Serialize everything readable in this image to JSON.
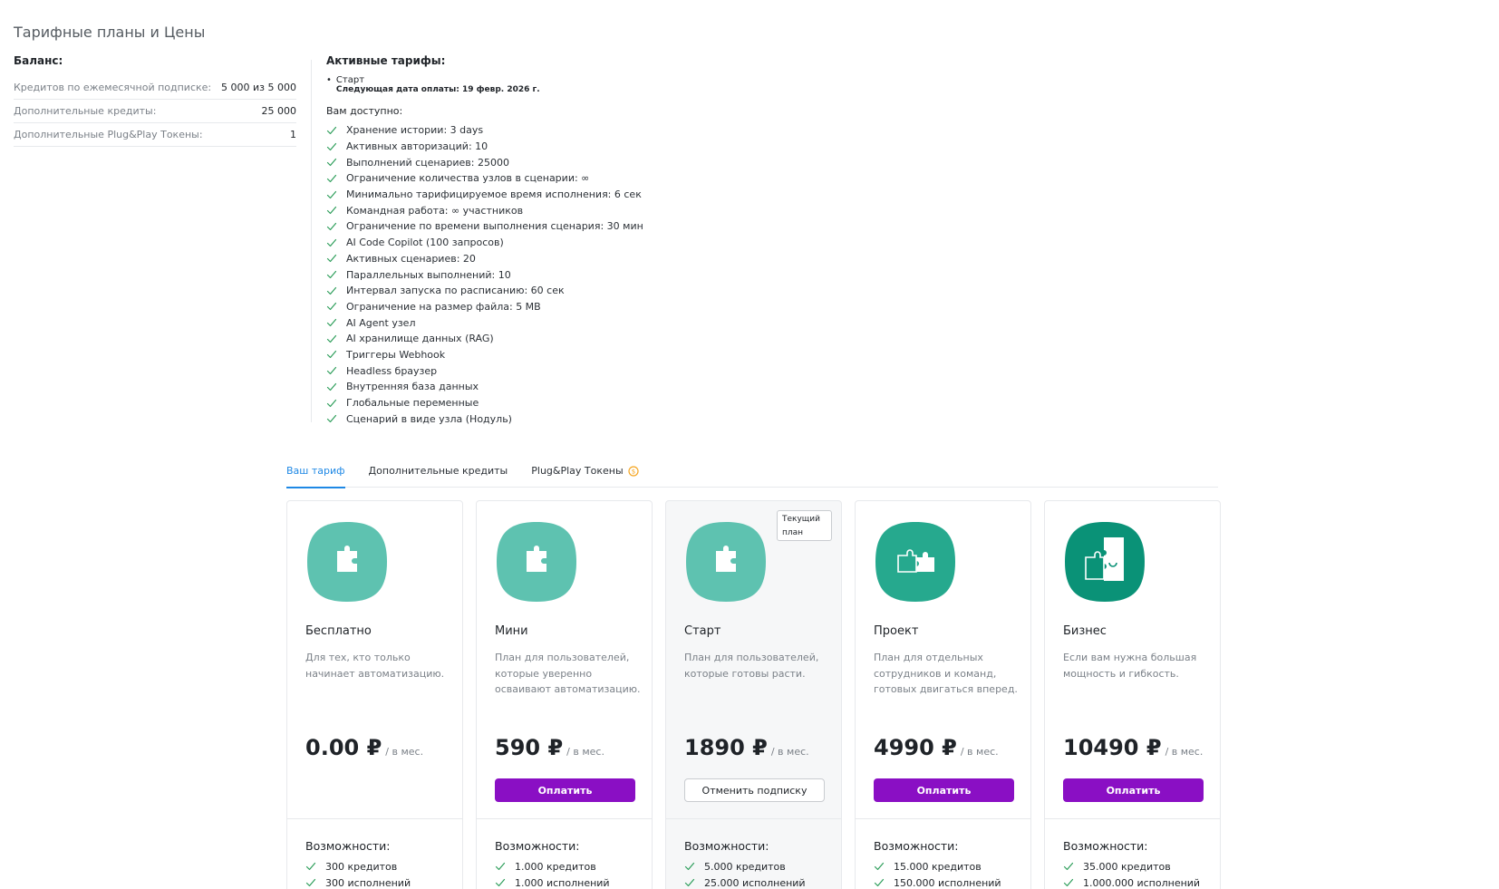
{
  "page_title": "Тарифные планы и Цены",
  "balance": {
    "title": "Баланс:",
    "rows": [
      {
        "label": "Кредитов по ежемесячной подписке:",
        "value": "5 000 из 5 000"
      },
      {
        "label": "Дополнительные кредиты:",
        "value": "25 000"
      },
      {
        "label": "Дополнительные Plug&Play Токены:",
        "value": "1"
      }
    ]
  },
  "active": {
    "title": "Активные тарифы:",
    "plan_name": "Старт",
    "next_payment": "Следующая дата оплаты: 19 февр. 2026 г.",
    "available_title": "Вам доступно:",
    "features": [
      "Хранение истории: 3 days",
      "Активных авторизаций: 10",
      "Выполнений сценариев: 25000",
      "Ограничение количества узлов в сценарии: ∞",
      "Минимально тарифицируемое время исполнения: 6 сек",
      "Командная работа: ∞ участников",
      "Ограничение по времени выполнения сценария: 30 мин",
      "AI Code Copilot (100 запросов)",
      "Активных сценариев: 20",
      "Параллельных выполнений: 10",
      "Интервал запуска по расписанию: 60 сек",
      "Ограничение на размер файла: 5 MB",
      "AI Agent узел",
      "AI хранилище данных (RAG)",
      "Триггеры Webhook",
      "Headless браузер",
      "Внутренняя база данных",
      "Глобальные переменные",
      "Сценарий в виде узла (Нодуль)"
    ]
  },
  "tabs": [
    "Ваш тариф",
    "Дополнительные кредиты",
    "Plug&Play Токены"
  ],
  "colors": {
    "accent_blue": "#1e88e5",
    "pay_button": "#8a0fc4",
    "check_green": "#2e9e5b",
    "icon_light": "#5ec2b0",
    "icon_mid": "#26a98e",
    "icon_dark": "#0a9277",
    "coin": "#f5a623"
  },
  "plans": [
    {
      "name": "Бесплатно",
      "desc": "Для тех, кто только начинает автоматизацию.",
      "price": "0.00 ₽",
      "per": "/ в мес.",
      "button": "",
      "features_title": "Возможности:",
      "features": [
        "300 кредитов",
        "300 исполнений"
      ],
      "icon": "puzzle-single-icon"
    },
    {
      "name": "Мини",
      "desc": "План для пользователей, которые уверенно осваивают автоматизацию.",
      "price": "590 ₽",
      "per": "/ в мес.",
      "button": "Оплатить",
      "features_title": "Возможности:",
      "features": [
        "1.000 кредитов",
        "1.000 исполнений"
      ],
      "icon": "puzzle-single-icon"
    },
    {
      "name": "Старт",
      "desc": "План для пользователей, которые готовы расти.",
      "price": "1890 ₽",
      "per": "/ в мес.",
      "button": "Отменить подписку",
      "badge": "Текущий план",
      "features_title": "Возможности:",
      "features": [
        "5.000 кредитов",
        "25.000 исполнений"
      ],
      "icon": "puzzle-single-icon"
    },
    {
      "name": "Проект",
      "desc": "План для отдельных сотрудников и команд, готовых двигаться вперед.",
      "price": "4990 ₽",
      "per": "/ в мес.",
      "button": "Оплатить",
      "features_title": "Возможности:",
      "features": [
        "15.000 кредитов",
        "150.000 исполнений"
      ],
      "icon": "puzzle-double-icon"
    },
    {
      "name": "Бизнес",
      "desc": "Если вам нужна большая мощность и гибкость.",
      "price": "10490 ₽",
      "per": "/ в мес.",
      "button": "Оплатить",
      "features_title": "Возможности:",
      "features": [
        "35.000 кредитов",
        "1.000.000 исполнений"
      ],
      "icon": "puzzle-triple-icon"
    }
  ]
}
